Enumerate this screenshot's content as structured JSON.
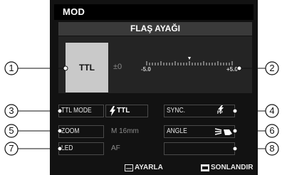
{
  "header": {
    "title": "MOD"
  },
  "section": {
    "title": "FLAŞ AYAĞI"
  },
  "flash_mode": {
    "selected": "TTL"
  },
  "compensation": {
    "value": "±0",
    "min_label": "-5.0",
    "max_label": "+5.0",
    "current": 0
  },
  "settings": {
    "ttl_mode": {
      "label": "TTL MODE",
      "value": "TTL",
      "icon": "flash-icon"
    },
    "sync": {
      "label": "SYNC.",
      "icon": "fp-flash-icon",
      "icon_text": "FP"
    },
    "zoom": {
      "label": "ZOOM",
      "value": "M 16mm"
    },
    "angle": {
      "label": "ANGLE",
      "icon": "flash-angle-icon"
    },
    "led": {
      "label": "LED",
      "value": "AF"
    }
  },
  "footer": {
    "set_label": "AYARLA",
    "set_icon": "ok-button-icon",
    "exit_label": "SONLANDIR",
    "exit_icon": "back-button-icon"
  },
  "callouts": [
    "1",
    "2",
    "3",
    "4",
    "5",
    "6",
    "7",
    "8"
  ]
}
